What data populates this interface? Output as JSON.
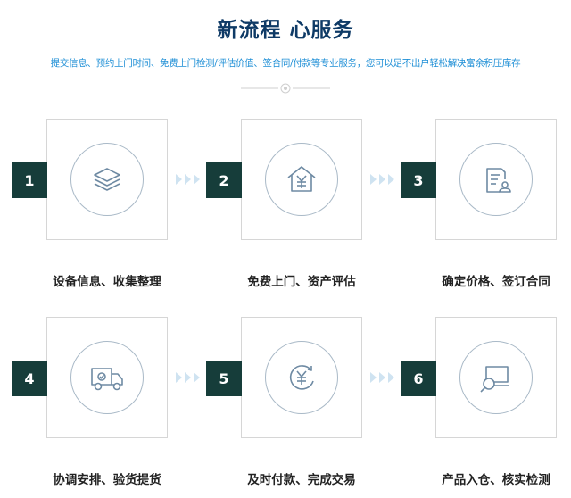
{
  "header": {
    "title": "新流程 心服务",
    "subtitle": "提交信息、预约上门时间、免费上门检测/评估价值、签合同/付款等专业服务，您可以足不出户轻松解决富余积压库存"
  },
  "colors": {
    "title": "#0e3a66",
    "subtitle": "#1f8fd6",
    "number_box": "#163d3a",
    "icon_stroke": "#6e8aa3",
    "chevron": "#cfe3f1"
  },
  "steps": [
    {
      "number": "1",
      "label": "设备信息、收集整理",
      "icon": "layers-icon"
    },
    {
      "number": "2",
      "label": "免费上门、资产评估",
      "icon": "house-yen-icon"
    },
    {
      "number": "3",
      "label": "确定价格、签订合同",
      "icon": "contract-icon"
    },
    {
      "number": "4",
      "label": "协调安排、验货提货",
      "icon": "truck-icon"
    },
    {
      "number": "5",
      "label": "及时付款、完成交易",
      "icon": "yen-refresh-icon"
    },
    {
      "number": "6",
      "label": "产品入仓、核实检测",
      "icon": "inspect-icon"
    }
  ]
}
